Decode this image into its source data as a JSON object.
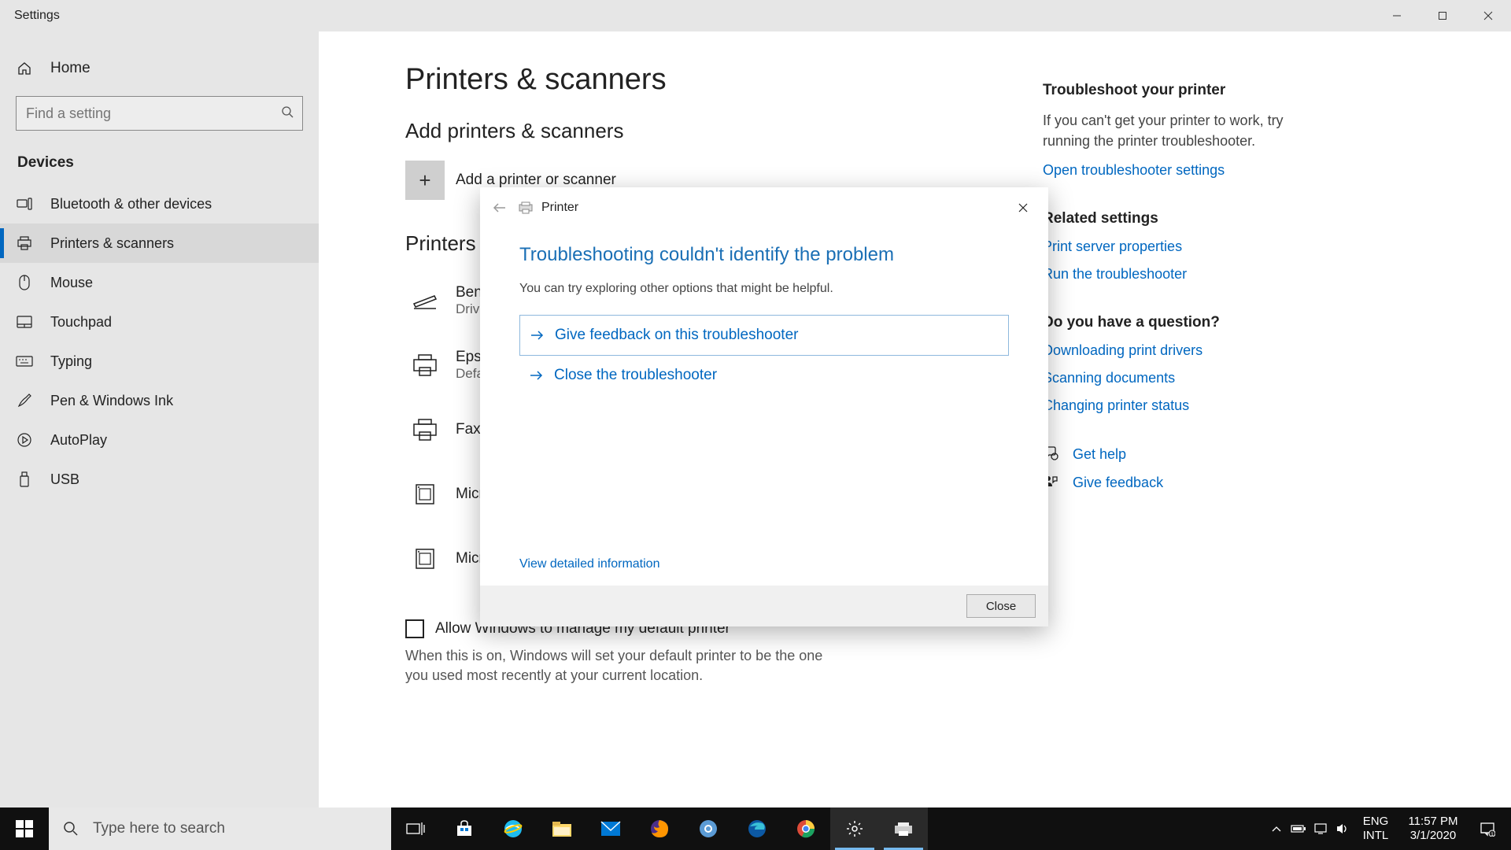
{
  "window": {
    "title": "Settings"
  },
  "sidebar": {
    "home": "Home",
    "search_placeholder": "Find a setting",
    "category": "Devices",
    "items": [
      {
        "label": "Bluetooth & other devices"
      },
      {
        "label": "Printers & scanners"
      },
      {
        "label": "Mouse"
      },
      {
        "label": "Touchpad"
      },
      {
        "label": "Typing"
      },
      {
        "label": "Pen & Windows Ink"
      },
      {
        "label": "AutoPlay"
      },
      {
        "label": "USB"
      }
    ]
  },
  "main": {
    "title": "Printers & scanners",
    "add_section": "Add printers & scanners",
    "add_label": "Add a printer or scanner",
    "list_section": "Printers & scanners",
    "printers": [
      {
        "name": "BenQ Scanner",
        "sub": "Driver error"
      },
      {
        "name": "Epson Stylus Photo",
        "sub": "Default, Offline"
      },
      {
        "name": "Fax",
        "sub": ""
      },
      {
        "name": "Microsoft Print to PDF",
        "sub": ""
      },
      {
        "name": "Microsoft XPS Document Writer",
        "sub": ""
      }
    ],
    "checkbox_label": "Allow Windows to manage my default printer",
    "checkbox_desc": "When this is on, Windows will set your default printer to be the one you used most recently at your current location."
  },
  "rightcol": {
    "troubleshoot_h": "Troubleshoot your printer",
    "troubleshoot_text": "If you can't get your printer to work, try running the printer troubleshooter.",
    "troubleshoot_link": "Open troubleshooter settings",
    "related_h": "Related settings",
    "related_links": [
      "Print server properties",
      "Run the troubleshooter"
    ],
    "question_h": "Do you have a question?",
    "question_links": [
      "Downloading print drivers",
      "Scanning documents",
      "Changing printer status"
    ],
    "gethelp": "Get help",
    "feedback": "Give feedback"
  },
  "dialog": {
    "title": "Printer",
    "heading": "Troubleshooting couldn't identify the problem",
    "text": "You can try exploring other options that might be helpful.",
    "option1": "Give feedback on this troubleshooter",
    "option2": "Close the troubleshooter",
    "detail_link": "View detailed information",
    "close_btn": "Close"
  },
  "taskbar": {
    "search_placeholder": "Type here to search",
    "lang1": "ENG",
    "lang2": "INTL",
    "time": "11:57 PM",
    "date": "3/1/2020"
  }
}
